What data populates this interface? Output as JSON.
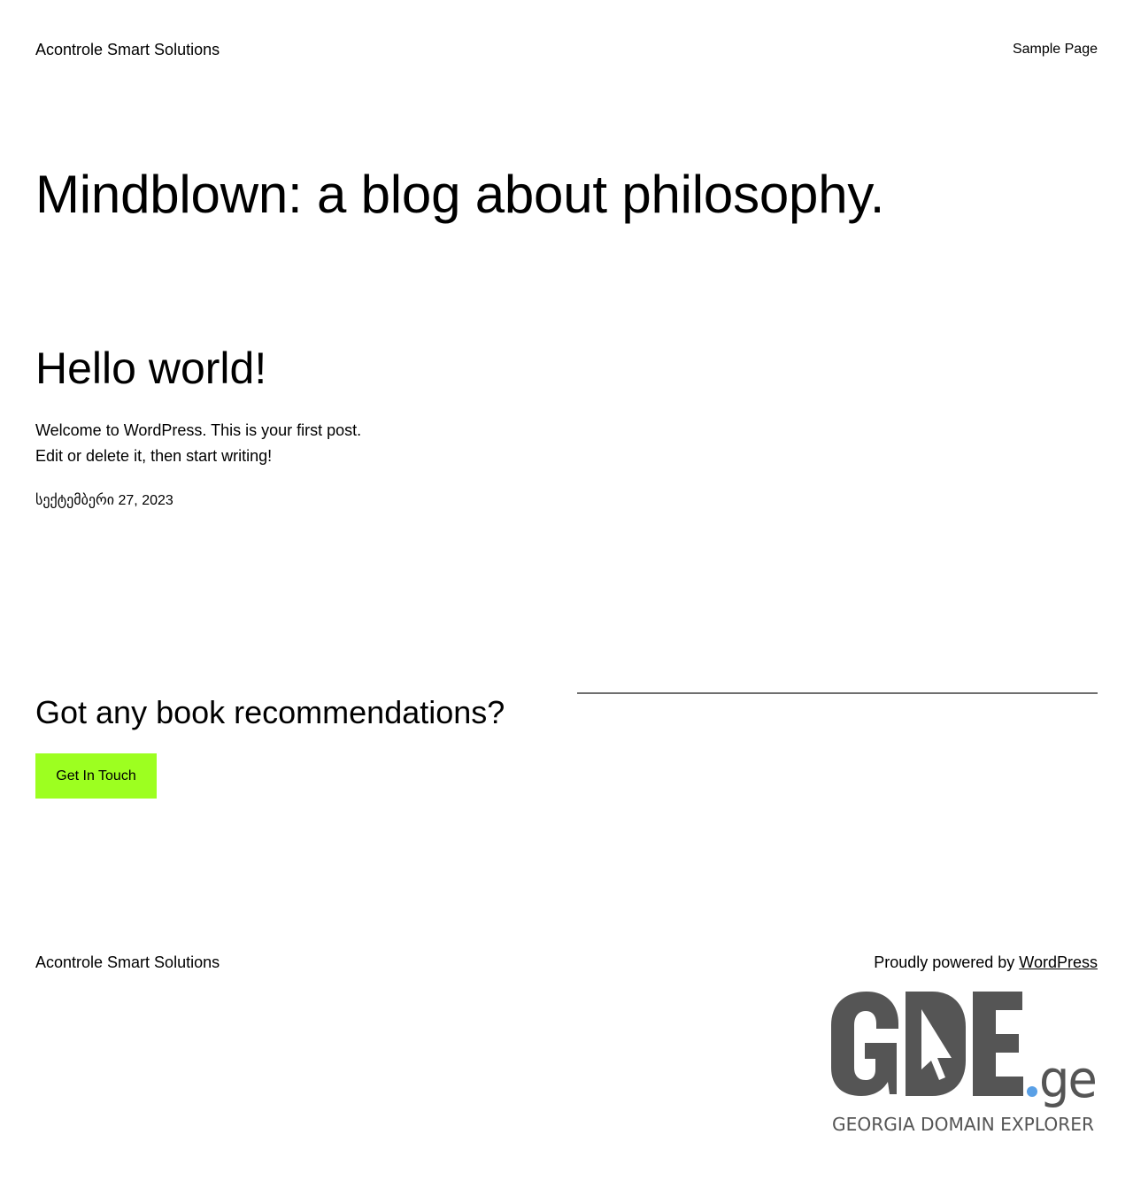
{
  "header": {
    "site_title": "Acontrole Smart Solutions",
    "nav": {
      "sample_page": "Sample Page"
    }
  },
  "hero": {
    "title": "Mindblown: a blog about philosophy."
  },
  "post": {
    "title": "Hello world!",
    "excerpt": "Welcome to WordPress. This is your first post. Edit or delete it, then start writing!",
    "date": "სექტემბერი 27, 2023"
  },
  "cta": {
    "heading": "Got any book recommendations?",
    "button_label": "Get In Touch",
    "button_color": "#9dff20"
  },
  "footer": {
    "site_title": "Acontrole Smart Solutions",
    "credit_prefix": "Proudly powered by ",
    "credit_link": "WordPress"
  },
  "badge": {
    "logo_text": "GDE.ge",
    "tagline": "GEORGIA DOMAIN EXPLORER",
    "logo_color": "#555555",
    "dot_color": "#5aa0e6"
  }
}
